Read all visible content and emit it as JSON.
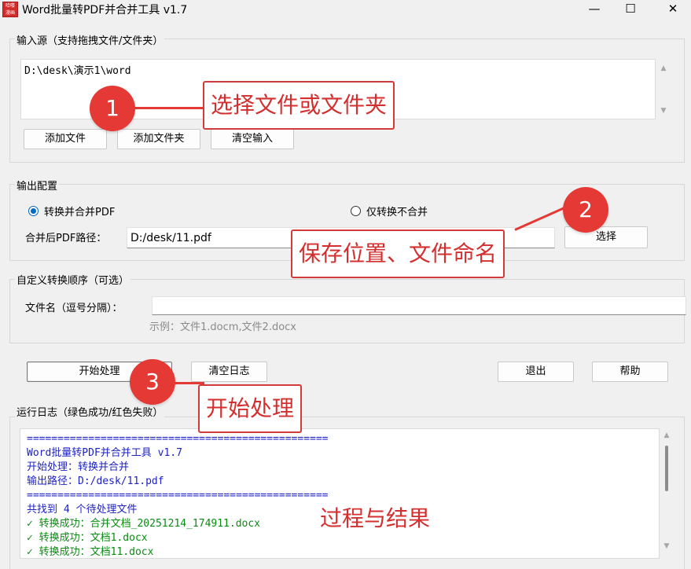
{
  "window": {
    "title": "Word批量转PDF并合并工具 v1.7",
    "icon_text": "哈喽 漫画",
    "minimize": "—",
    "maximize": "☐",
    "close": "✕"
  },
  "input_group": {
    "label": "输入源（支持拖拽文件/文件夹）",
    "text_value": "D:\\desk\\演示1\\word",
    "add_file": "添加文件",
    "add_folder": "添加文件夹",
    "clear_input": "清空输入"
  },
  "output_group": {
    "label": "输出配置",
    "radio_merge": "转换并合并PDF",
    "radio_merge_selected": true,
    "radio_convert_only": "仅转换不合并",
    "path_label": "合并后PDF路径：",
    "path_value": "D:/desk/11.pdf",
    "choose_button": "选择"
  },
  "order_group": {
    "label": "自定义转换顺序（可选）",
    "filename_label": "文件名（逗号分隔）：",
    "filename_value": "",
    "example_text": "示例：文件1.docm,文件2.docx"
  },
  "actions": {
    "start": "开始处理",
    "clear_log": "清空日志",
    "exit": "退出",
    "help": "帮助"
  },
  "log_group": {
    "label": "运行日志（绿色成功/红色失败）",
    "lines": [
      {
        "text": "=================================================",
        "color": "blue"
      },
      {
        "text": "Word批量转PDF并合并工具 v1.7",
        "color": "blue"
      },
      {
        "text": "开始处理：转换并合并",
        "color": "blue"
      },
      {
        "text": "输出路径：D:/desk/11.pdf",
        "color": "blue"
      },
      {
        "text": "=================================================",
        "color": "blue"
      },
      {
        "text": "共找到 4 个待处理文件",
        "color": "blue"
      },
      {
        "text": "✓ 转换成功：合并文档_20251214_174911.docx",
        "color": "green"
      },
      {
        "text": "✓ 转换成功：文档1.docx",
        "color": "green"
      },
      {
        "text": "✓ 转换成功：文档11.docx",
        "color": "green"
      }
    ]
  },
  "annotations": {
    "step1_number": "1",
    "step1_text": "选择文件或文件夹",
    "step2_number": "2",
    "step2_text": "保存位置、文件命名",
    "step3_number": "3",
    "step3_text": "开始处理",
    "result_text": "过程与结果"
  },
  "colors": {
    "accent_red": "#e53935",
    "log_blue": "#1e22c2",
    "log_green": "#0a8a12",
    "radio_blue": "#0067c0"
  }
}
